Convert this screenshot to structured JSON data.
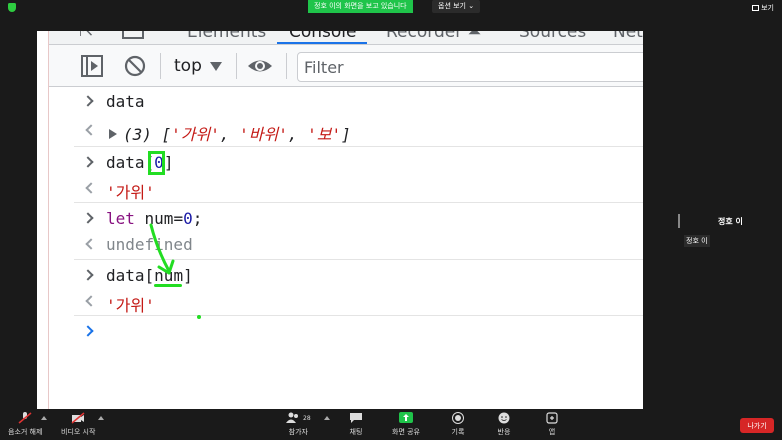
{
  "zoom_top": {
    "share_banner": "정호 이의 화면을 보고 있습니다",
    "view_options": "옵션 보기 ⌄",
    "view_button": "보기"
  },
  "devtools": {
    "tabs": [
      "Elements",
      "Console",
      "Recorder ⏶",
      "Sources",
      "Net"
    ],
    "active_tab": "Console",
    "context_selector": "top",
    "filter_placeholder": "Filter"
  },
  "console": {
    "row1_input": "data",
    "row1_output_count": "(3)",
    "row1_output_open": " [",
    "row1_item1": "'가위'",
    "row1_sep1": ", ",
    "row1_item2": "'바위'",
    "row1_sep2": ", ",
    "row1_item3": "'보'",
    "row1_output_close": "]",
    "row2_input_prefix": "data[",
    "row2_input_index": "0",
    "row2_input_suffix": "]",
    "row2_output": "'가위'",
    "row3_kw": "let",
    "row3_mid": " num=",
    "row3_num": "0",
    "row3_end": ";",
    "row3_output": "undefined",
    "row4_input_prefix": "data[",
    "row4_input_var": "num",
    "row4_input_suffix": "]",
    "row4_output": "'가위'"
  },
  "participant": {
    "name": "정호 이",
    "label": "정호 이"
  },
  "bottom_bar": {
    "unmute": "음소거 해제",
    "video": "비디오 시작",
    "participants": "참가자",
    "participants_count": "28",
    "chat": "채팅",
    "share": "화면 공유",
    "record": "기록",
    "reactions": "반응",
    "apps": "앱",
    "leave": "나가기"
  },
  "colors": {
    "share_green": "#1fc44a",
    "leave_red": "#d62626",
    "annotation_green": "#22dd22",
    "keyword": "#881280",
    "number": "#1a1aa6",
    "string": "#c41a16"
  }
}
